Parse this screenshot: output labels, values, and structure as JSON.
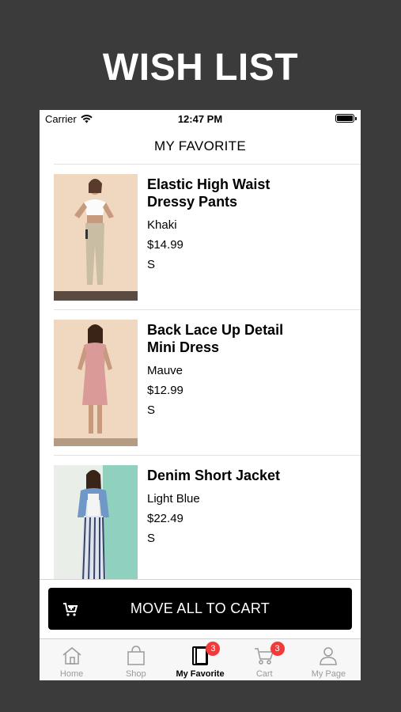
{
  "banner": {
    "title": "WISH LIST"
  },
  "status_bar": {
    "carrier": "Carrier",
    "time": "12:47 PM"
  },
  "nav": {
    "title": "MY FAVORITE"
  },
  "items": [
    {
      "name": "Elastic High Waist Dressy Pants",
      "color": "Khaki",
      "price": "$14.99",
      "size": "S"
    },
    {
      "name": "Back Lace Up Detail Mini Dress",
      "color": "Mauve",
      "price": "$12.99",
      "size": "S"
    },
    {
      "name": "Denim Short Jacket",
      "color": "Light Blue",
      "price": "$22.49",
      "size": "S"
    }
  ],
  "cart_button": {
    "label": "MOVE ALL TO CART",
    "icon": "cart-plus-icon"
  },
  "tabs": [
    {
      "label": "Home",
      "icon": "home-icon"
    },
    {
      "label": "Shop",
      "icon": "shopping-bag-icon"
    },
    {
      "label": "My Favorite",
      "icon": "favorite-book-icon",
      "badge": "3",
      "active": true
    },
    {
      "label": "Cart",
      "icon": "cart-icon",
      "badge": "3"
    },
    {
      "label": "My Page",
      "icon": "user-icon"
    }
  ],
  "colors": {
    "background": "#3b3b3b",
    "badge": "#f23a3a",
    "button": "#000000"
  }
}
